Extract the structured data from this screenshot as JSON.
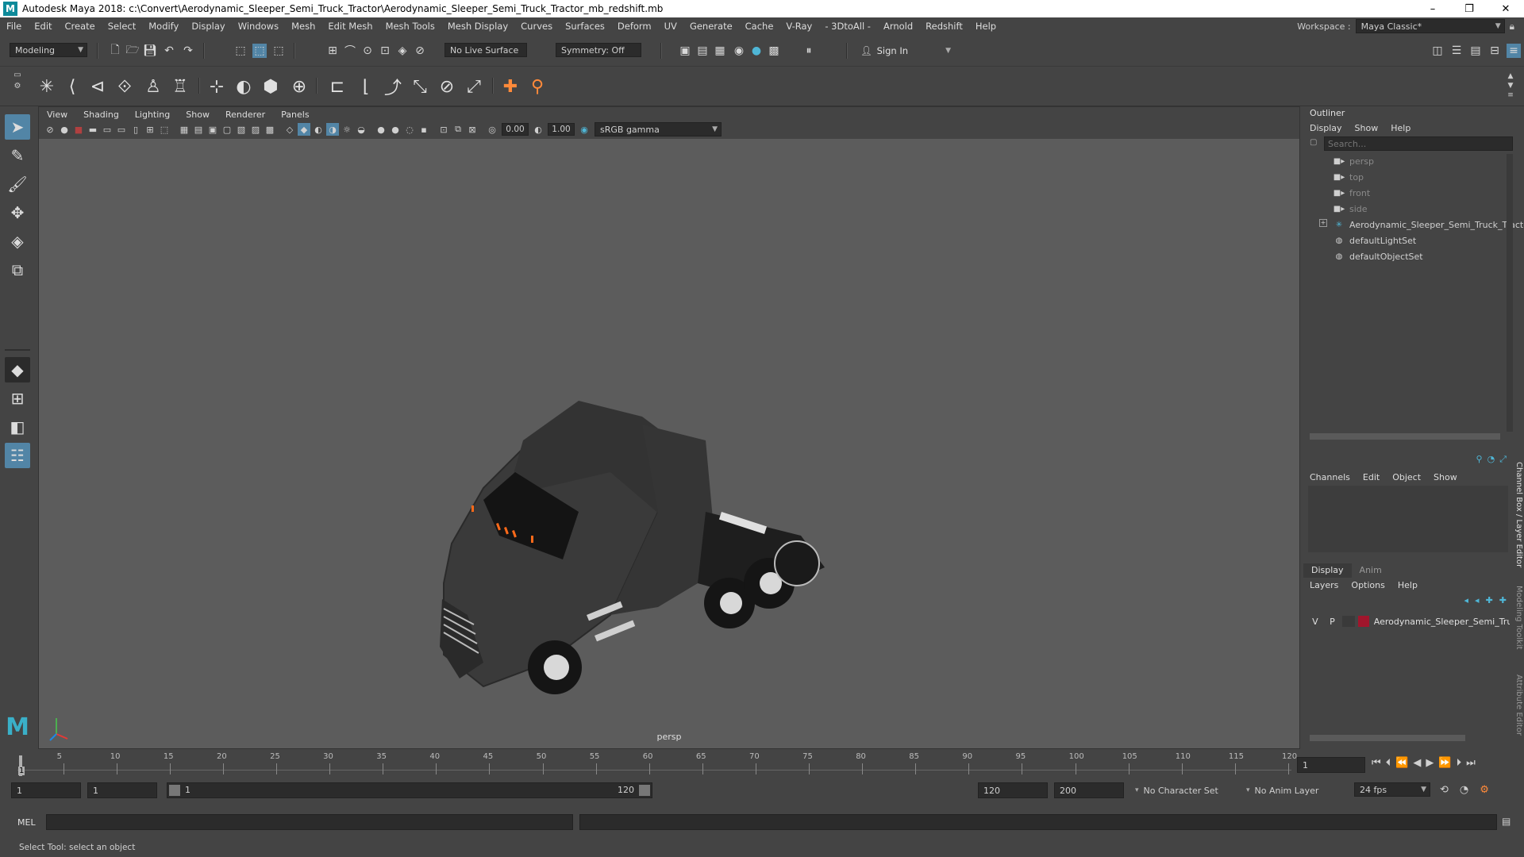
{
  "window": {
    "logo": "M",
    "title": "Autodesk Maya 2018: c:\\Convert\\Aerodynamic_Sleeper_Semi_Truck_Tractor\\Aerodynamic_Sleeper_Semi_Truck_Tractor_mb_redshift.mb",
    "minimize": "–",
    "maximize": "❐",
    "close": "✕"
  },
  "menubar": {
    "items": [
      "File",
      "Edit",
      "Create",
      "Select",
      "Modify",
      "Display",
      "Windows",
      "Mesh",
      "Edit Mesh",
      "Mesh Tools",
      "Mesh Display",
      "Curves",
      "Surfaces",
      "Deform",
      "UV",
      "Generate",
      "Cache",
      "V-Ray",
      "- 3DtoAll -",
      "Arnold",
      "Redshift",
      "Help"
    ],
    "workspace_label": "Workspace :",
    "workspace_value": "Maya Classic*"
  },
  "statusline": {
    "mode": "Modeling",
    "live_surface": "No Live Surface",
    "symmetry": "Symmetry: Off",
    "sign_in": "Sign In"
  },
  "viewport": {
    "menus": [
      "View",
      "Shading",
      "Lighting",
      "Show",
      "Renderer",
      "Panels"
    ],
    "exposure": "0.00",
    "gamma": "1.00",
    "colorspace": "sRGB gamma",
    "camera_label": "persp"
  },
  "outliner": {
    "title": "Outliner",
    "menus": [
      "Display",
      "Show",
      "Help"
    ],
    "search_placeholder": "Search...",
    "items": [
      {
        "label": "persp",
        "type": "camera"
      },
      {
        "label": "top",
        "type": "camera"
      },
      {
        "label": "front",
        "type": "camera"
      },
      {
        "label": "side",
        "type": "camera"
      },
      {
        "label": "Aerodynamic_Sleeper_Semi_Truck_Tracto",
        "type": "group"
      },
      {
        "label": "defaultLightSet",
        "type": "set"
      },
      {
        "label": "defaultObjectSet",
        "type": "set"
      }
    ]
  },
  "channelbox": {
    "menus": [
      "Channels",
      "Edit",
      "Object",
      "Show"
    ],
    "side_tab": "Channel Box / Layer Editor"
  },
  "layereditor": {
    "tabs": [
      "Display",
      "Anim"
    ],
    "menus": [
      "Layers",
      "Options",
      "Help"
    ],
    "layer": {
      "v": "V",
      "p": "P",
      "name": "Aerodynamic_Sleeper_Semi_Tru",
      "color": "#a0162c"
    }
  },
  "side_tabs": [
    "Modeling Toolkit",
    "Attribute Editor"
  ],
  "timeslider": {
    "ticks": [
      "5",
      "10",
      "15",
      "20",
      "25",
      "30",
      "35",
      "40",
      "45",
      "50",
      "55",
      "60",
      "65",
      "70",
      "75",
      "80",
      "85",
      "90",
      "95",
      "100",
      "105",
      "110",
      "115",
      "120"
    ],
    "current_frame_marker": "1",
    "current_frame": "1"
  },
  "range": {
    "start": "1",
    "playback_start": "1",
    "slider_start": "1",
    "slider_end": "120",
    "playback_end": "120",
    "end": "200",
    "character_set": "No Character Set",
    "anim_layer": "No Anim Layer",
    "fps": "24 fps"
  },
  "cmdline": {
    "label": "MEL"
  },
  "helpline": {
    "text": "Select Tool: select an object"
  }
}
